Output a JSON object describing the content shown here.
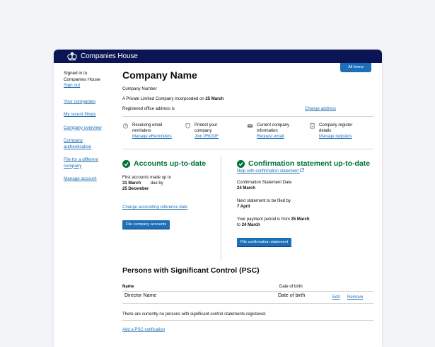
{
  "header": {
    "brand": "Companies House"
  },
  "all_forms": "All forms",
  "sidebar": {
    "signed_in_line1": "Signed in to",
    "signed_in_line2": "Companies House",
    "sign_out": "Sign out",
    "items": [
      {
        "label": "Your companies"
      },
      {
        "label": "My recent filings"
      },
      {
        "label": "Company overview"
      },
      {
        "label": "Company authentication"
      },
      {
        "label": "File for a different company"
      },
      {
        "label": "Manage account"
      }
    ]
  },
  "company": {
    "name": "Company Name",
    "number_label": "Company Number",
    "incorporated_prefix": "A Private Limited Company incorporated on",
    "incorporated_date": "25 March",
    "address_label": "Registered office address is",
    "change_address": "Change address"
  },
  "info": [
    {
      "icon": "alarm-clock-icon",
      "text1": "Receiving email",
      "text2": "reminders",
      "link": "Manage eReminders"
    },
    {
      "icon": "shield-icon",
      "text1": "Protect your",
      "text2": "company",
      "link": "Join PROOF"
    },
    {
      "icon": "envelope-icon",
      "text1": "Current company",
      "text2": "information",
      "link": "Request email"
    },
    {
      "icon": "register-book-icon",
      "text1": "Company register",
      "text2": "details",
      "link": "Manage registers"
    }
  ],
  "accounts": {
    "heading": "Accounts up-to-date",
    "first_label": "First accounts made up to",
    "made_up_date": "31 March",
    "due_label": "due by",
    "due_date": "25 December",
    "change_link": "Change accounting reference date",
    "button": "File company accounts"
  },
  "confirmation": {
    "heading": "Confirmation statement up-to-date",
    "help_link": "Help with confirmation statement",
    "date_label": "Confirmation Statement Date",
    "date": "24 March",
    "next_label": "Next statement to be filed by",
    "next_date": "7 April",
    "period_prefix": "Your payment period is from",
    "period_from": "25 March",
    "period_to_prefix": "to",
    "period_to": "24 March",
    "button": "File confirmation statement"
  },
  "psc": {
    "heading": "Persons with Significant Control (PSC)",
    "col_name": "Name",
    "col_dob": "Date of birth",
    "row_name": "Director Name",
    "row_dob": "Date of birth",
    "edit": "Edit",
    "remove": "Remove",
    "no_statements": "There are currently no persons with significant control statements registered.",
    "add_link": "Add a PSC notification"
  }
}
